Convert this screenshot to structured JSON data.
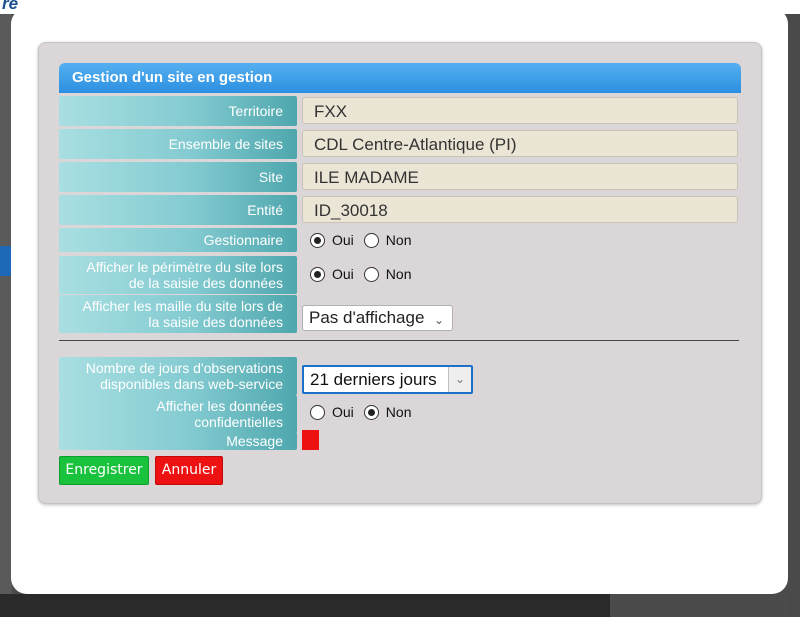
{
  "background": {
    "header_text": "re"
  },
  "panel": {
    "title": "Gestion d'un site en gestion"
  },
  "fields": {
    "territoire": {
      "label": "Territoire",
      "value": "FXX"
    },
    "ensemble": {
      "label": "Ensemble de sites",
      "value": "CDL Centre-Atlantique (PI)"
    },
    "site": {
      "label": "Site",
      "value": "ILE MADAME"
    },
    "entite": {
      "label": "Entité",
      "value": "ID_30018"
    }
  },
  "gestionnaire": {
    "label": "Gestionnaire",
    "options": [
      "Oui",
      "Non"
    ],
    "selected": "Oui"
  },
  "perimetre": {
    "label_line1": "Afficher le périmètre du site lors",
    "label_line2": "de la saisie des données",
    "options": [
      "Oui",
      "Non"
    ],
    "selected": "Oui"
  },
  "maille": {
    "label_line1": "Afficher les maille du site lors de",
    "label_line2": "la saisie des données",
    "selected_value": "Pas d'affichage"
  },
  "jours": {
    "label_line1": "Nombre de jours d'observations",
    "label_line2": "disponibles dans web-service",
    "selected_value": "21 derniers jours"
  },
  "confidentielles": {
    "label_line1": "Afficher les données",
    "label_line2": "confidentielles",
    "options": [
      "Oui",
      "Non"
    ],
    "selected": "Non"
  },
  "message": {
    "label": "Message",
    "indicator_color": "#ee1111"
  },
  "buttons": {
    "save": "Enregistrer",
    "cancel": "Annuler"
  },
  "colors": {
    "title_bar": "#2c8fe0",
    "label_bg": "#83cbd1",
    "field_bg": "#ebe5d5",
    "save_green": "#19c23c",
    "cancel_red": "#ee1111",
    "focus_border": "#1e6fc8"
  }
}
